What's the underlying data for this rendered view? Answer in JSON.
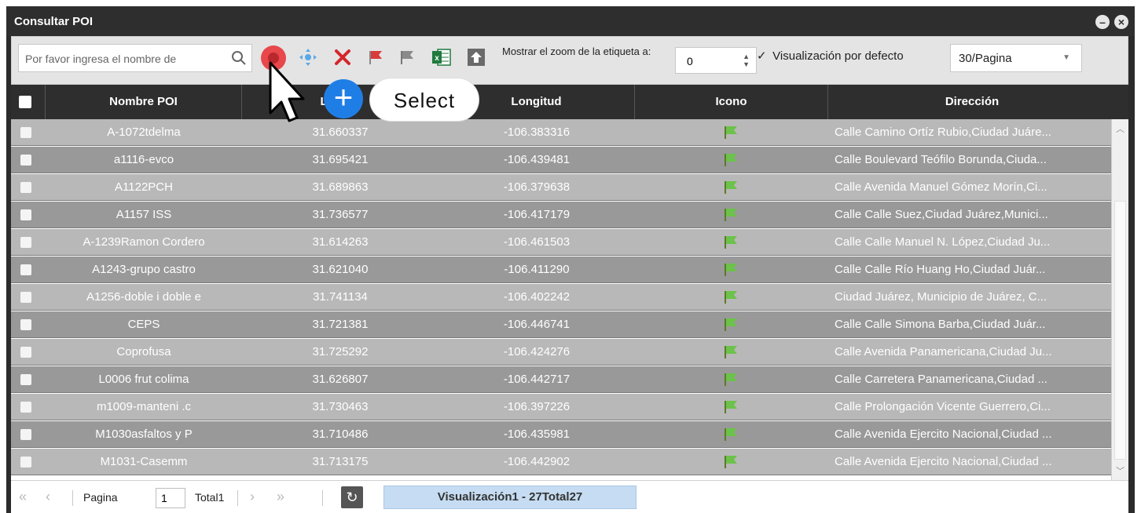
{
  "window": {
    "title": "Consultar POI"
  },
  "toolbar": {
    "search_placeholder": "Por favor ingresa el nombre de",
    "zoom_label": "Mostrar el zoom de la etiqueta a:",
    "zoom_value": "0",
    "default_view_label": "Visualización por defecto",
    "default_view_checked": true,
    "page_size": "30/Pagina"
  },
  "grid": {
    "columns": [
      "Nombre POI",
      "Latitud",
      "Longitud",
      "Icono",
      "Dirección"
    ],
    "rows": [
      {
        "name": "A-1072tdelma",
        "lat": "31.660337",
        "lng": "-106.383316",
        "address": "Calle Camino Ortíz Rubio,Ciudad Juáre..."
      },
      {
        "name": "a1116-evco",
        "lat": "31.695421",
        "lng": "-106.439481",
        "address": "Calle Boulevard Teófilo Borunda,Ciuda..."
      },
      {
        "name": "A1122PCH",
        "lat": "31.689863",
        "lng": "-106.379638",
        "address": "Calle Avenida Manuel Gómez Morín,Ci..."
      },
      {
        "name": "A1157 ISS",
        "lat": "31.736577",
        "lng": "-106.417179",
        "address": "Calle Calle Suez,Ciudad Juárez,Munici..."
      },
      {
        "name": "A-1239Ramon Cordero",
        "lat": "31.614263",
        "lng": "-106.461503",
        "address": "Calle Calle Manuel N. López,Ciudad Ju..."
      },
      {
        "name": "A1243-grupo castro",
        "lat": "31.621040",
        "lng": "-106.411290",
        "address": "Calle Calle Río Huang Ho,Ciudad Juár..."
      },
      {
        "name": "A1256-doble i doble e",
        "lat": "31.741134",
        "lng": "-106.402242",
        "address": "Ciudad Juárez, Municipio de Juárez, C..."
      },
      {
        "name": "CEPS",
        "lat": "31.721381",
        "lng": "-106.446741",
        "address": "Calle Calle Simona Barba,Ciudad Juár..."
      },
      {
        "name": "Coprofusa",
        "lat": "31.725292",
        "lng": "-106.424276",
        "address": "Calle Avenida Panamericana,Ciudad Ju..."
      },
      {
        "name": "L0006 frut colima",
        "lat": "31.626807",
        "lng": "-106.442717",
        "address": "Calle Carretera Panamericana,Ciudad ..."
      },
      {
        "name": "m1009-manteni .c",
        "lat": "31.730463",
        "lng": "-106.397226",
        "address": "Calle Prolongación Vicente Guerrero,Ci..."
      },
      {
        "name": "M1030asfaltos y P",
        "lat": "31.710486",
        "lng": "-106.435981",
        "address": "Calle Avenida Ejercito Nacional,Ciudad ..."
      },
      {
        "name": "M1031-Casemm",
        "lat": "31.713175",
        "lng": "-106.442902",
        "address": "Calle Avenida Ejercito Nacional,Ciudad ..."
      }
    ]
  },
  "pager": {
    "page_label": "Pagina",
    "page_value": "1",
    "total_label": "Total1",
    "status": "Visualización1 - 27Total27"
  },
  "overlay": {
    "select_label": "Select"
  },
  "colors": {
    "header_bg": "#2e2e2e",
    "row_light": "#b8b8b8",
    "row_dark": "#999999",
    "status_bg": "#c5dcf2",
    "accent_blue": "#1f7ee6",
    "highlight_red": "#e8474b"
  }
}
